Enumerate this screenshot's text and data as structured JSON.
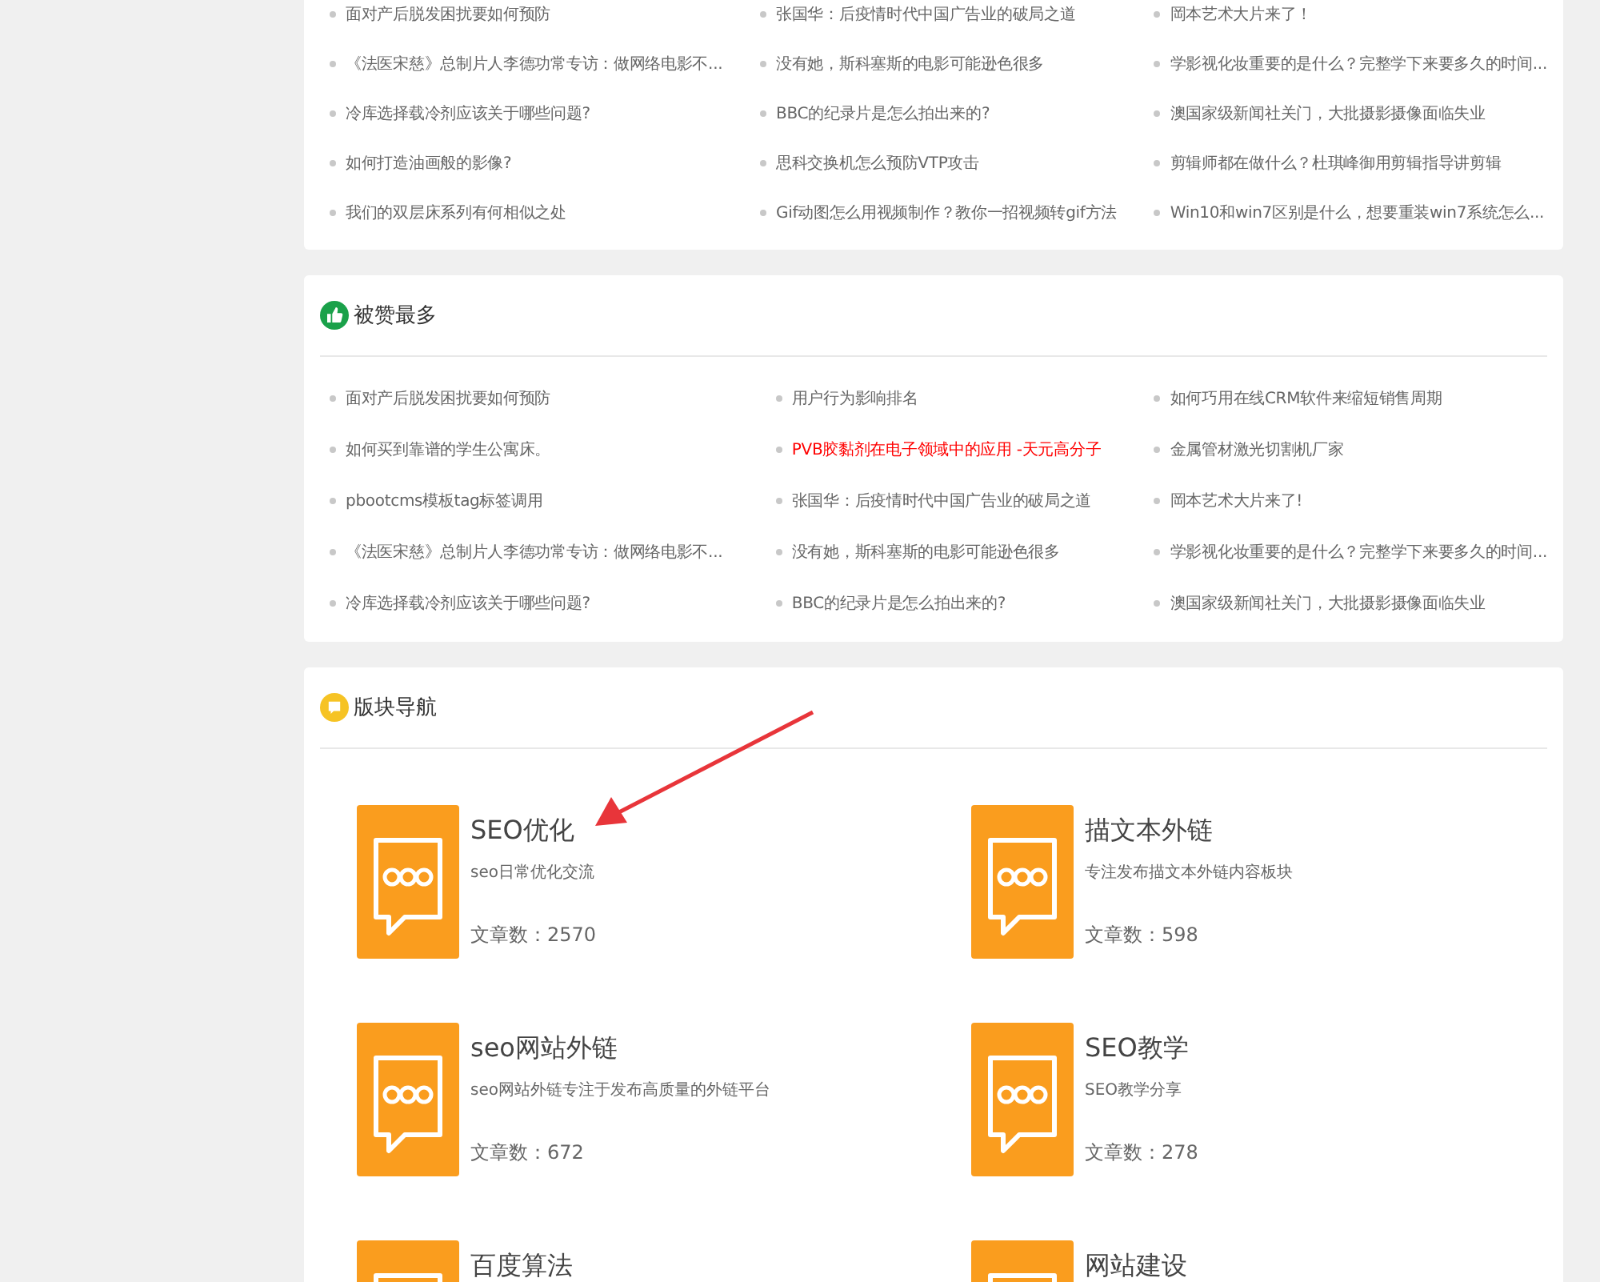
{
  "sections": [
    {
      "kind": "list",
      "items": [
        {
          "text": "面对产后脱发困扰要如何预防",
          "highlighted": false
        },
        {
          "text": "张国华：后疫情时代中国广告业的破局之道",
          "highlighted": false
        },
        {
          "text": "岡本艺术大片来了！",
          "highlighted": false
        },
        {
          "text": "《法医宋慈》总制片人李德功常专访：做网络电影不...",
          "highlighted": false
        },
        {
          "text": "没有她，斯科塞斯的电影可能逊色很多",
          "highlighted": false
        },
        {
          "text": "学影视化妆重要的是什么？完整学下来要多久的时间...",
          "highlighted": false
        },
        {
          "text": "冷库选择载冷剂应该关于哪些问题?",
          "highlighted": false
        },
        {
          "text": "BBC的纪录片是怎么拍出来的?",
          "highlighted": false
        },
        {
          "text": "澳国家级新闻社关门，大批摄影摄像面临失业",
          "highlighted": false
        },
        {
          "text": "如何打造油画般的影像?",
          "highlighted": false
        },
        {
          "text": "思科交换机怎么预防VTP攻击",
          "highlighted": false
        },
        {
          "text": "剪辑师都在做什么？杜琪峰御用剪辑指导讲剪辑",
          "highlighted": false
        },
        {
          "text": "我们的双层床系列有何相似之处",
          "highlighted": false
        },
        {
          "text": "Gif动图怎么用视频制作？教你一招视频转gif方法",
          "highlighted": false
        },
        {
          "text": "Win10和win7区别是什么，想要重装win7系统怎么...",
          "highlighted": false
        }
      ]
    },
    {
      "kind": "list",
      "title": "被赞最多",
      "items": [
        {
          "text": "面对产后脱发困扰要如何预防",
          "highlighted": false
        },
        {
          "text": "用户行为影响排名",
          "highlighted": false
        },
        {
          "text": "如何巧用在线CRM软件来缩短销售周期",
          "highlighted": false
        },
        {
          "text": "如何买到靠谱的学生公寓床。",
          "highlighted": false
        },
        {
          "text": "PVB胶黏剂在电子领域中的应用 -天元高分子",
          "highlighted": true
        },
        {
          "text": "金属管材激光切割机厂家",
          "highlighted": false
        },
        {
          "text": "pbootcms模板tag标签调用",
          "highlighted": false
        },
        {
          "text": "张国华：后疫情时代中国广告业的破局之道",
          "highlighted": false
        },
        {
          "text": "岡本艺术大片来了!",
          "highlighted": false
        },
        {
          "text": "《法医宋慈》总制片人李德功常专访：做网络电影不...",
          "highlighted": false
        },
        {
          "text": "没有她，斯科塞斯的电影可能逊色很多",
          "highlighted": false
        },
        {
          "text": "学影视化妆重要的是什么？完整学下来要多久的时间...",
          "highlighted": false
        },
        {
          "text": "冷库选择载冷剂应该关于哪些问题?",
          "highlighted": false
        },
        {
          "text": "BBC的纪录片是怎么拍出来的?",
          "highlighted": false
        },
        {
          "text": "澳国家级新闻社关门，大批摄影摄像面临失业",
          "highlighted": false
        }
      ]
    },
    {
      "kind": "boards",
      "title": "版块导航",
      "boards": [
        {
          "name": "SEO优化",
          "description": "seo日常优化交流",
          "count": "文章数：2570"
        },
        {
          "name": "描文本外链",
          "description": "专注发布描文本外链内容板块",
          "count": "文章数：598"
        },
        {
          "name": "seo网站外链",
          "description": "seo网站外链专注于发布高质量的外链平台",
          "count": "文章数：672"
        },
        {
          "name": "SEO教学",
          "description": "SEO教学分享",
          "count": "文章数：278"
        },
        {
          "name": "百度算法"
        },
        {
          "name": "网站建设"
        }
      ]
    }
  ]
}
